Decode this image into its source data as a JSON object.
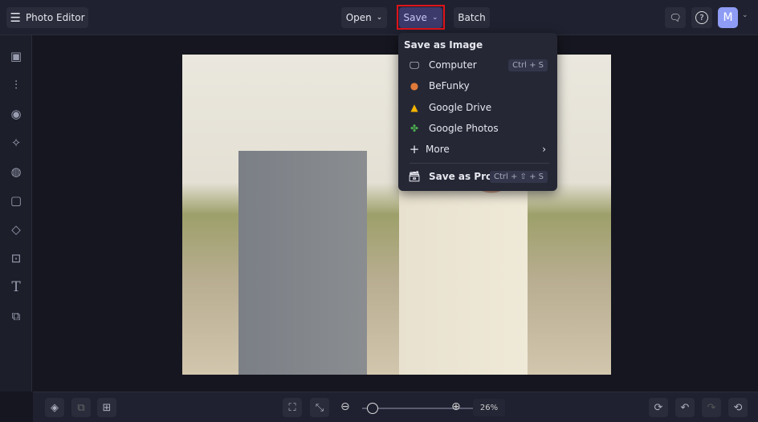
{
  "header": {
    "app_title": "Photo Editor",
    "open_label": "Open",
    "save_label": "Save",
    "batch_label": "Batch",
    "avatar_initial": "M"
  },
  "save_menu": {
    "heading": "Save as Image",
    "items": [
      {
        "label": "Computer",
        "shortcut": "Ctrl + S",
        "icon": "monitor-icon"
      },
      {
        "label": "BeFunky",
        "icon": "befunky-icon"
      },
      {
        "label": "Google Drive",
        "icon": "google-drive-icon"
      },
      {
        "label": "Google Photos",
        "icon": "google-photos-icon"
      },
      {
        "label": "More",
        "icon": "plus-icon"
      },
      {
        "label": "Save as Project",
        "shortcut": "Ctrl + ⇧ + S",
        "icon": "briefcase-icon"
      }
    ]
  },
  "sidebar": [
    "image-icon",
    "sliders-icon",
    "eye-icon",
    "sparkles-icon",
    "palette-icon",
    "frame-icon",
    "shapes-icon",
    "texture-icon",
    "text-icon",
    "overlay-icon"
  ],
  "zoom": {
    "value": "26%",
    "level": 0.05
  },
  "colors": {
    "highlight": "#e0131b",
    "save_bg": "#3b3a6b",
    "avatar": "#8f9cf5"
  }
}
